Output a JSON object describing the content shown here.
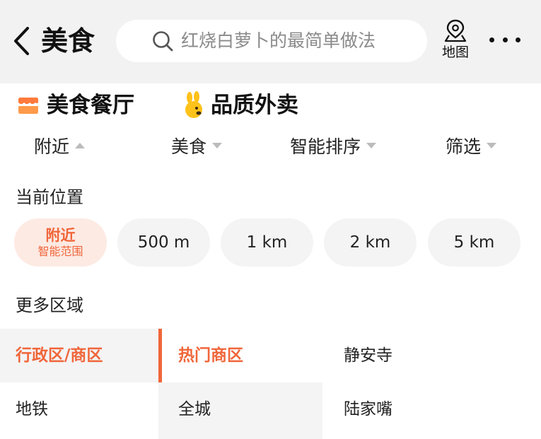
{
  "header": {
    "title": "美食",
    "search_placeholder": "红烧白萝卜的最简单做法",
    "map_label": "地图"
  },
  "tabs": [
    {
      "label": "美食餐厅",
      "active": true,
      "icon": "shop-icon"
    },
    {
      "label": "品质外卖",
      "active": false,
      "icon": "kangaroo-mascot-icon"
    }
  ],
  "filters": [
    {
      "label": "附近",
      "arrow": "up"
    },
    {
      "label": "美食",
      "arrow": "down"
    },
    {
      "label": "智能排序",
      "arrow": "down"
    },
    {
      "label": "筛选",
      "arrow": "down"
    }
  ],
  "current_position": {
    "title": "当前位置",
    "chips": [
      {
        "label": "附近",
        "sub": "智能范围",
        "active": true
      },
      {
        "label": "500 m"
      },
      {
        "label": "1 km"
      },
      {
        "label": "2 km"
      },
      {
        "label": "5 km"
      }
    ]
  },
  "more_areas": {
    "title": "更多区域",
    "categories": [
      "行政区/商区",
      "地铁"
    ],
    "sub_categories": [
      "热门商区",
      "全城"
    ],
    "areas": [
      "静安寺",
      "陆家嘴"
    ]
  },
  "colors": {
    "accent": "#f0663a",
    "header_bg": "#f2f2f2",
    "chip_bg": "#f4f4f4",
    "chip_active_bg": "#fdeae3"
  }
}
